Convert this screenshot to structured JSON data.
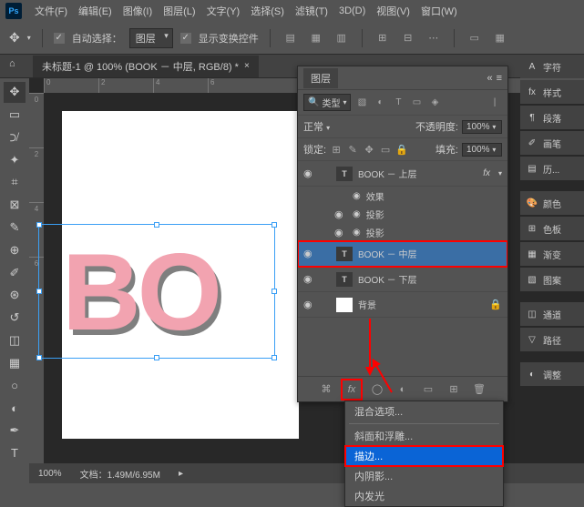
{
  "menubar": {
    "logo": "Ps",
    "items": [
      "文件(F)",
      "编辑(E)",
      "图像(I)",
      "图层(L)",
      "文字(Y)",
      "选择(S)",
      "滤镜(T)",
      "3D(D)",
      "视图(V)",
      "窗口(W)"
    ]
  },
  "optbar": {
    "auto_select": "自动选择：",
    "auto_select_dd": "图层",
    "show_transform": "显示变换控件"
  },
  "doc_tab": "未标题-1 @ 100% (BOOK － 中层, RGB/8) *",
  "ruler_h": [
    "0",
    "2",
    "4",
    "6"
  ],
  "ruler_v": [
    "0",
    "2",
    "4",
    "6"
  ],
  "canvas_text": "BO",
  "layers_panel": {
    "title": "图层",
    "search_label": "类型",
    "blend_mode": "正常",
    "opacity_label": "不透明度:",
    "opacity_value": "100%",
    "lock_label": "锁定:",
    "fill_label": "填充:",
    "fill_value": "100%",
    "layers": [
      {
        "name": "BOOK － 上层",
        "type": "T",
        "fx": true,
        "open": true
      },
      {
        "name": "效果",
        "sub": true
      },
      {
        "name": "投影",
        "sub": true,
        "eye": true
      },
      {
        "name": "投影",
        "sub": true,
        "eye": true
      },
      {
        "name": "BOOK － 中层",
        "type": "T",
        "selected": true
      },
      {
        "name": "BOOK － 下层",
        "type": "T"
      },
      {
        "name": "背景",
        "type": "bg",
        "lock": true
      }
    ]
  },
  "fx_menu": {
    "items": [
      "混合选项...",
      "斜面和浮雕...",
      "描边...",
      "内阴影...",
      "内发光"
    ],
    "highlight_index": 2
  },
  "right_panels": [
    "字符",
    "样式",
    "段落",
    "画笔",
    "历...",
    "颜色",
    "色板",
    "渐变",
    "图案",
    "通道",
    "路径",
    "调整"
  ],
  "statusbar": {
    "zoom": "100%",
    "docinfo": "文档：1.49M/6.95M"
  }
}
